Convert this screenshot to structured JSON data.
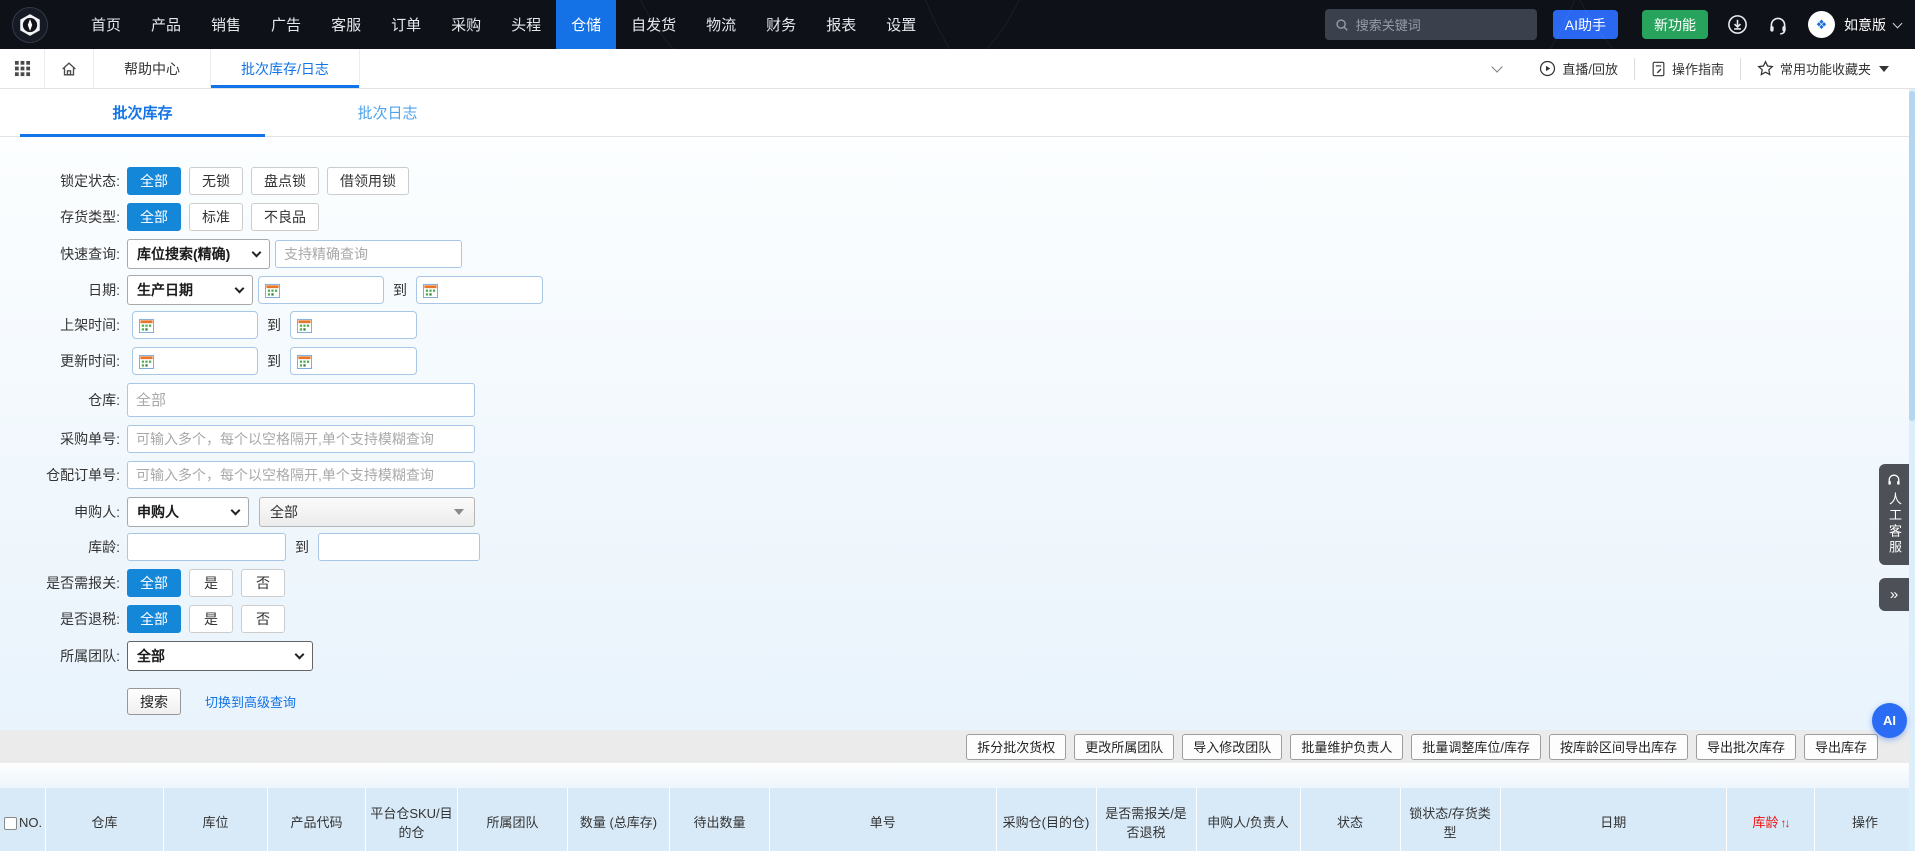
{
  "topnav": {
    "items": [
      {
        "label": "首页"
      },
      {
        "label": "产品"
      },
      {
        "label": "销售"
      },
      {
        "label": "广告"
      },
      {
        "label": "客服"
      },
      {
        "label": "订单"
      },
      {
        "label": "采购"
      },
      {
        "label": "头程"
      },
      {
        "label": "仓储",
        "active": true
      },
      {
        "label": "自发货"
      },
      {
        "label": "物流"
      },
      {
        "label": "财务"
      },
      {
        "label": "报表"
      },
      {
        "label": "设置"
      }
    ],
    "search_placeholder": "搜索关键词",
    "ai_button": "AI助手",
    "new_feature_button": "新功能",
    "version_label": "如意版"
  },
  "tabbar": {
    "tabs": [
      {
        "label": "帮助中心"
      },
      {
        "label": "批次库存/日志",
        "active": true
      }
    ],
    "live_replay": "直播/回放",
    "guide": "操作指南",
    "favorites": "常用功能收藏夹"
  },
  "subtabs": [
    {
      "label": "批次库存",
      "active": true
    },
    {
      "label": "批次日志"
    }
  ],
  "filters": {
    "to_label": "到",
    "lock_status": {
      "label": "锁定状态:",
      "options": [
        {
          "label": "全部",
          "active": true
        },
        {
          "label": "无锁"
        },
        {
          "label": "盘点锁"
        },
        {
          "label": "借领用锁"
        }
      ]
    },
    "stock_type": {
      "label": "存货类型:",
      "options": [
        {
          "label": "全部",
          "active": true
        },
        {
          "label": "标准"
        },
        {
          "label": "不良品"
        }
      ]
    },
    "quick_query": {
      "label": "快速查询:",
      "select_value": "库位搜索(精确)",
      "placeholder": "支持精确查询"
    },
    "date": {
      "label": "日期:",
      "select_value": "生产日期"
    },
    "shelf_time": {
      "label": "上架时间:"
    },
    "update_time": {
      "label": "更新时间:"
    },
    "warehouse": {
      "label": "仓库:",
      "placeholder": "全部"
    },
    "purchase_no": {
      "label": "采购单号:",
      "placeholder": "可输入多个，每个以空格隔开,单个支持模糊查询"
    },
    "allocation_no": {
      "label": "仓配订单号:",
      "placeholder": "可输入多个，每个以空格隔开,单个支持模糊查询"
    },
    "applicant": {
      "label": "申购人:",
      "select_value": "申购人",
      "value": "全部"
    },
    "stock_age": {
      "label": "库龄:"
    },
    "customs": {
      "label": "是否需报关:",
      "options": [
        {
          "label": "全部",
          "active": true
        },
        {
          "label": "是"
        },
        {
          "label": "否"
        }
      ]
    },
    "tax_refund": {
      "label": "是否退税:",
      "options": [
        {
          "label": "全部",
          "active": true
        },
        {
          "label": "是"
        },
        {
          "label": "否"
        }
      ]
    },
    "team": {
      "label": "所属团队:",
      "select_value": "全部"
    },
    "search_button": "搜索",
    "advanced_link": "切换到高级查询"
  },
  "actions": [
    "拆分批次货权",
    "更改所属团队",
    "导入修改团队",
    "批量维护负责人",
    "批量调整库位/库存",
    "按库龄区间导出库存",
    "导出批次库存",
    "导出库存"
  ],
  "table": {
    "columns": [
      "NO.",
      "仓库",
      "库位",
      "产品代码",
      "平台仓SKU/目的仓",
      "所属团队",
      "数量 (总库存)",
      "待出数量",
      "单号",
      "采购仓(目的仓)",
      "是否需报关/是否退税",
      "申购人/负责人",
      "状态",
      "锁状态/存货类型",
      "日期",
      "库龄",
      "操作"
    ],
    "sort_icons": {
      "up": "↑",
      "down": "↓"
    }
  },
  "floating": {
    "service_label": "人工客服",
    "collapse_icon": "»",
    "ai_label": "AI"
  },
  "colors": {
    "accent_blue": "#1374e8",
    "toggle_active_blue": "#1587d9",
    "nav_active_blue": "#1472e6",
    "ai_button_blue": "#2a68f2",
    "new_feature_green": "#27a35d",
    "age_sort_red": "#ee1111",
    "table_header_bg": "#d8eaf8"
  }
}
